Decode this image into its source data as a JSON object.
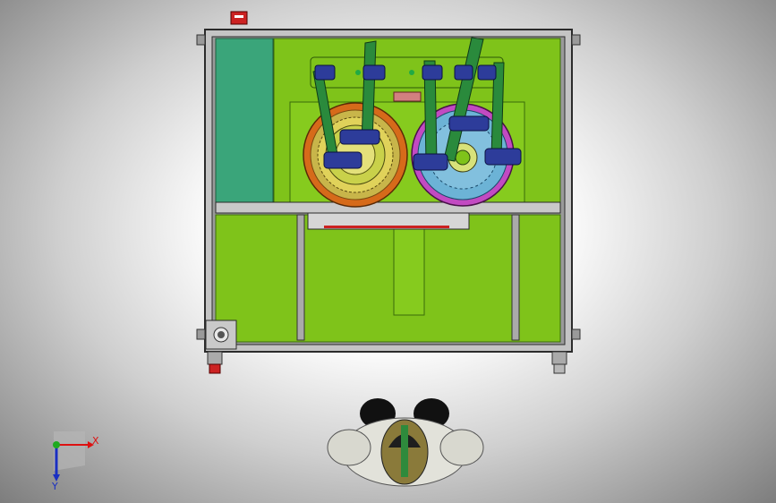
{
  "viewport": {
    "projection": "top view",
    "background": "gradient-grey"
  },
  "colors": {
    "frame": "#b8b8b8",
    "frame_edge": "#2b2b2b",
    "panel_green": "#7fc31a",
    "panel_green_dark": "#5d9b10",
    "teal_panel": "#3aa57a",
    "slot_green": "#2a8a3c",
    "ring_orange": "#d66a1a",
    "ring_yellow": "#d3c43a",
    "ring_magenta": "#c24ac2",
    "ring_blue": "#6cb3d6",
    "motor_blue": "#2d3c9a",
    "accent_red": "#c22",
    "operator_helmet": "#8a7a3a"
  },
  "triad": {
    "x_label": "X",
    "y_label": "Y",
    "x_color": "#d11",
    "y_color": "#1a2fc2",
    "origin_color": "#1faa1f"
  },
  "parts": {
    "left_ring_icon": "stator-ring",
    "right_ring_icon": "rotor-ring",
    "operator_icon": "operator-figure",
    "foot_icon": "leveling-foot"
  }
}
